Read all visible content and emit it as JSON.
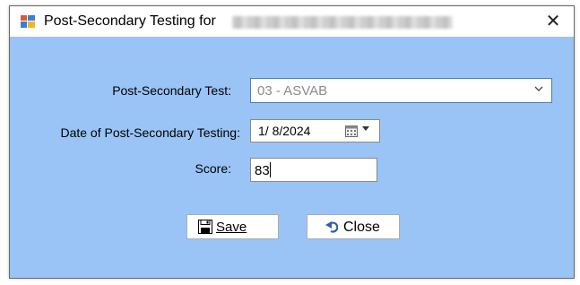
{
  "window": {
    "title": "Post-Secondary Testing for",
    "title_redacted": true,
    "close_glyph": "✕"
  },
  "form": {
    "test_label": "Post-Secondary Test:",
    "test_value": "03 - ASVAB",
    "date_label": "Date of Post-Secondary Testing:",
    "date_value": "1/ 8/2024",
    "score_label": "Score:",
    "score_value": "83"
  },
  "buttons": {
    "save_label": "Save",
    "close_label": "Close"
  },
  "icons": {
    "app": "app-window-icon",
    "dropdown": "chevron-down-icon",
    "calendar": "calendar-icon",
    "save": "floppy-disk-icon",
    "close": "undo-arrow-icon"
  },
  "colors": {
    "dialog_background": "#99c4f5",
    "combo_border": "#4a7fc1",
    "disabled_text": "#8a8a8a"
  }
}
